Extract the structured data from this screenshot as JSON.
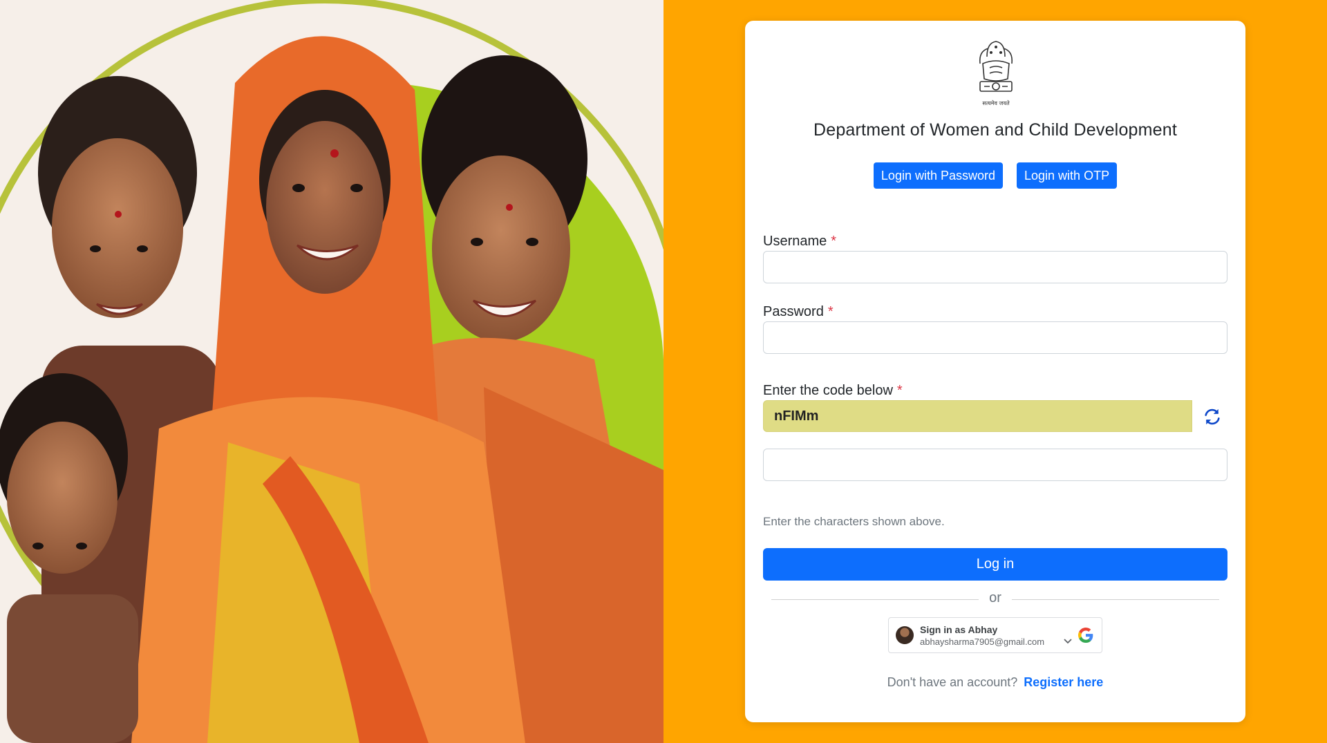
{
  "hero": {
    "image_alt": "Portrait of Indian women and a girl smiling"
  },
  "emblem": {
    "motto": "सत्यमेव जयते"
  },
  "header": {
    "title": "Department of Women and Child Development"
  },
  "login_modes": {
    "password_label": "Login with Password",
    "otp_label": "Login with OTP"
  },
  "form": {
    "username_label": "Username",
    "username_value": "",
    "password_label": "Password",
    "password_value": "",
    "required_marker": "*",
    "captcha_label": "Enter the code below",
    "captcha_code": "nFIMm",
    "captcha_input_value": "",
    "captcha_help": "Enter the characters shown above.",
    "login_button": "Log in"
  },
  "divider": {
    "text": "or"
  },
  "google_signin": {
    "title": "Sign in as Abhay",
    "email": "abhaysharma7905@gmail.com"
  },
  "register": {
    "prompt": "Don't have an account?",
    "link_label": "Register here"
  },
  "colors": {
    "page_background": "#FFA500",
    "primary": "#0d6efd",
    "captcha_background": "#dfdc85",
    "required": "#dc3545"
  }
}
